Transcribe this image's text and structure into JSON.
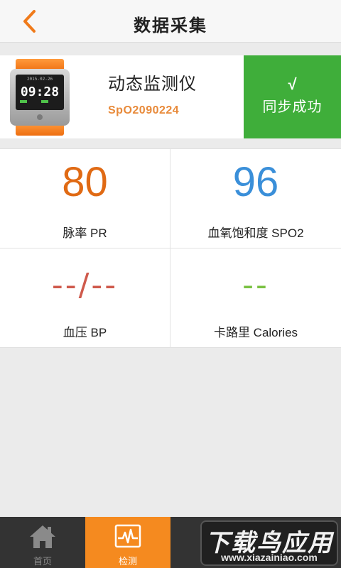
{
  "header": {
    "title": "数据采集",
    "back_icon": "chevron-left-icon",
    "accent": "#f07a1a"
  },
  "device": {
    "name": "动态监测仪",
    "id": "SpO2090224",
    "screen_date": "2015-02-26",
    "screen_time": "09:28"
  },
  "sync": {
    "check": "√",
    "label": "同步成功",
    "color": "#3fae3a"
  },
  "metrics": {
    "pulse": {
      "value": "80",
      "label": "脉率 PR",
      "color": "#e06a14"
    },
    "spo2": {
      "value": "96",
      "label": "血氧饱和度 SPO2",
      "color": "#3a8fd9"
    },
    "bp": {
      "value": "--/--",
      "label": "血压 BP",
      "color": "#cf5a4c"
    },
    "calories": {
      "value": "--",
      "label": "卡路里 Calories",
      "color": "#7ac142"
    }
  },
  "tabs": [
    {
      "label": "首页",
      "icon": "home-icon"
    },
    {
      "label": "检测",
      "icon": "pulse-monitor-icon"
    }
  ],
  "watermark": {
    "text": "下载鸟应用",
    "url": "www.xiazainiao.com"
  }
}
